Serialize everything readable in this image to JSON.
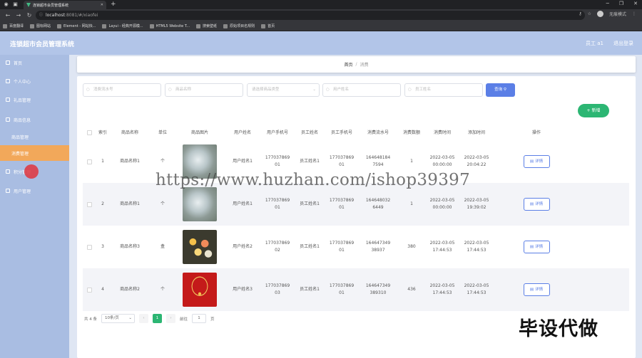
{
  "browser": {
    "tab_title": "连锁超市会员管理系统",
    "url_host": "localhost",
    "url_rest": ":8081/#/xiaofei",
    "profile_label": "无痕模式",
    "bookmarks": [
      "百度翻译",
      "图标网站",
      "Element - 网站快...",
      "Layui - 经典开源模...",
      "HTML5 Website T...",
      "搜索壁纸",
      "原始项目名规则",
      "首页"
    ]
  },
  "app": {
    "title": "连锁超市会员管理系统",
    "user": "员工 a1",
    "logout": "退出登录"
  },
  "sidebar": {
    "items": [
      {
        "label": "首页"
      },
      {
        "label": "个人中心"
      },
      {
        "label": "礼品管理"
      },
      {
        "label": "商品信息"
      },
      {
        "label": "商品管理"
      },
      {
        "label": "消费管理"
      },
      {
        "label": "积分管理"
      },
      {
        "label": "用户管理"
      }
    ]
  },
  "breadcrumb": {
    "home": "首页",
    "sep": "/",
    "current": "消费"
  },
  "search": {
    "fields": [
      {
        "placeholder": "消费流水号"
      },
      {
        "placeholder": "商品名称"
      },
      {
        "placeholder": "请选择商品类型"
      },
      {
        "placeholder": "用户姓名"
      },
      {
        "placeholder": "员工姓名"
      }
    ],
    "button": "查询"
  },
  "add_button": "+ 新增",
  "table": {
    "headers": [
      "",
      "索引",
      "商品名称",
      "单位",
      "商品图片",
      "用户姓名",
      "用户手机号",
      "员工姓名",
      "员工手机号",
      "消费流水号",
      "消费数额",
      "消费时间",
      "添加时间",
      "操作"
    ],
    "rows": [
      {
        "index": "1",
        "name": "商品名称1",
        "unit": "个",
        "img": "jewelry",
        "user": "用户姓名1",
        "uphone": "17703786901",
        "staff": "员工姓名1",
        "sphone": "17703786901",
        "serial": "1646481847594",
        "amount": "1",
        "time": "2022-03-05 00:00:00",
        "added": "2022-03-05 20:04:22",
        "action": "详情"
      },
      {
        "index": "2",
        "name": "商品名称1",
        "unit": "个",
        "img": "jewelry",
        "user": "用户姓名1",
        "uphone": "17703786901",
        "staff": "员工姓名1",
        "sphone": "17703786901",
        "serial": "1646480326449",
        "amount": "1",
        "time": "2022-03-05 00:00:00",
        "added": "2022-03-05 19:39:02",
        "action": "详情"
      },
      {
        "index": "3",
        "name": "商品名称3",
        "unit": "盒",
        "img": "flowers",
        "user": "用户姓名2",
        "uphone": "17703786902",
        "staff": "员工姓名1",
        "sphone": "17703786901",
        "serial": "164647349 38937",
        "amount": "380",
        "time": "2022-03-05 17:44:53",
        "added": "2022-03-05 17:44:53",
        "action": "详情"
      },
      {
        "index": "4",
        "name": "商品名称2",
        "unit": "个",
        "img": "necklace",
        "user": "用户姓名3",
        "uphone": "17703786903",
        "staff": "员工姓名1",
        "sphone": "17703786901",
        "serial": "164647349389310",
        "amount": "436",
        "time": "2022-03-05 17:44:53",
        "added": "2022-03-05 17:44:53",
        "action": "详情"
      }
    ]
  },
  "pager": {
    "total": "共 4 条",
    "size": "10条/页",
    "current": "1",
    "goto": "前往",
    "goto_val": "1",
    "page_unit": "页"
  },
  "overlay": {
    "watermark": "https://www.huzhan.com/ishop39397",
    "brand": "毕设代做"
  }
}
